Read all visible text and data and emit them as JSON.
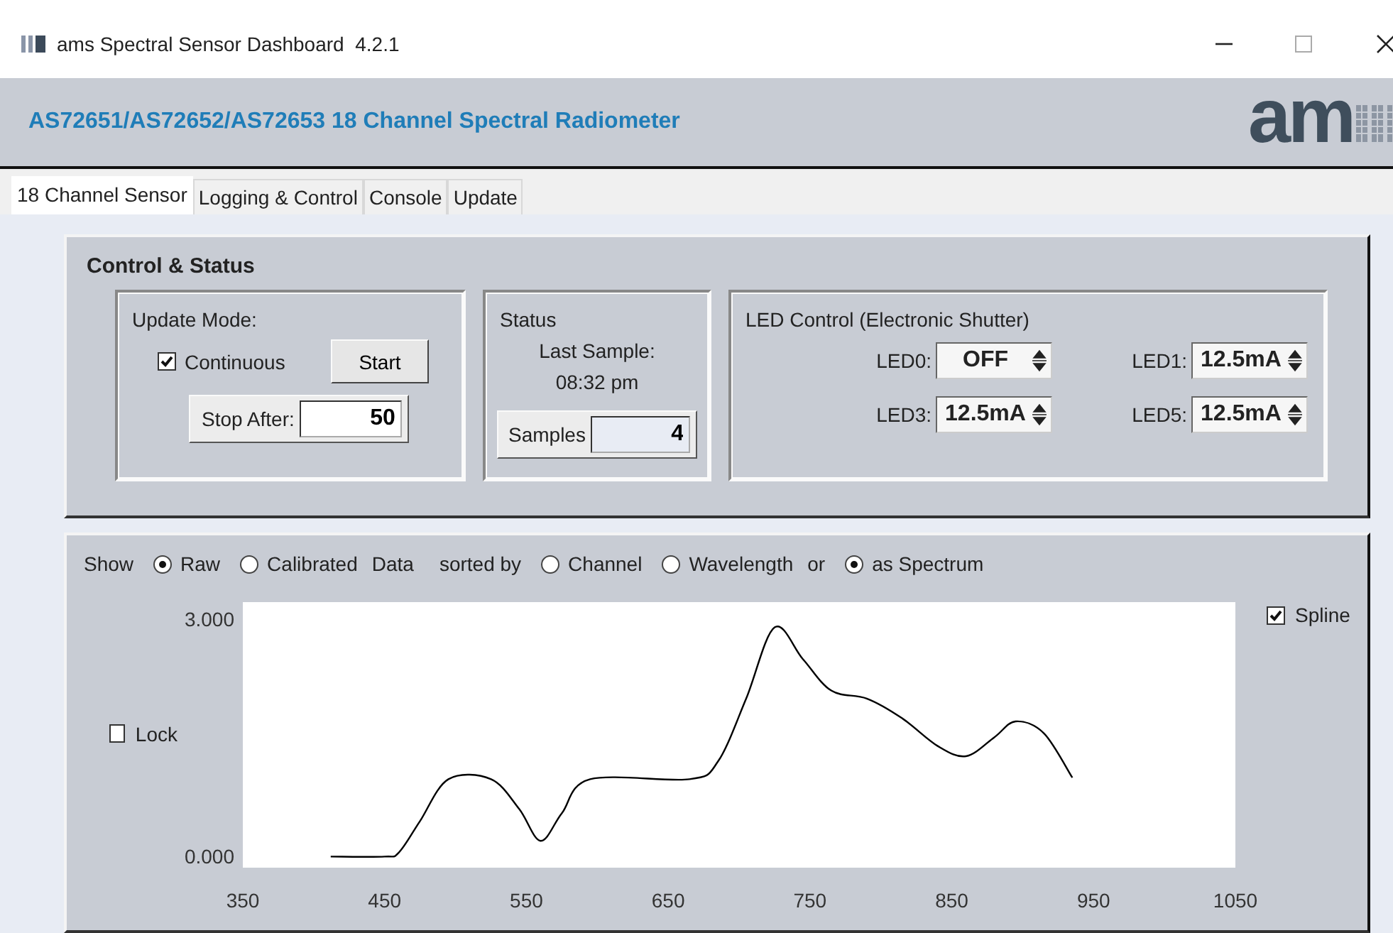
{
  "window": {
    "title": "ams Spectral Sensor Dashboard  4.2.1"
  },
  "header": {
    "title": "AS72651/AS72652/AS72653 18 Channel Spectral Radiometer",
    "logo": "am"
  },
  "tabs": [
    {
      "label": "18 Channel Sensor",
      "selected": true
    },
    {
      "label": "Logging & Control",
      "selected": false
    },
    {
      "label": "Console",
      "selected": false
    },
    {
      "label": "Update",
      "selected": false
    }
  ],
  "control_status": {
    "title": "Control & Status",
    "update_mode": {
      "title": "Update Mode:",
      "continuous": {
        "label": "Continuous",
        "checked": true
      },
      "start_button": "Start",
      "stop_after": {
        "label": "Stop After:",
        "value": "50"
      }
    },
    "status": {
      "title": "Status",
      "last_sample_label": "Last Sample:",
      "last_sample_time": "08:32 pm",
      "samples": {
        "label": "Samples",
        "value": "4"
      }
    },
    "led_control": {
      "title": "LED Control (Electronic Shutter)",
      "leds": [
        {
          "label": "LED0:",
          "value": "OFF"
        },
        {
          "label": "LED1:",
          "value": "12.5mA"
        },
        {
          "label": "LED3:",
          "value": "12.5mA"
        },
        {
          "label": "LED5:",
          "value": "12.5mA"
        }
      ]
    }
  },
  "display": {
    "show_label": "Show",
    "data_options": [
      {
        "label": "Raw",
        "selected": true
      },
      {
        "label": "Calibrated",
        "selected": false
      }
    ],
    "data_label": "Data",
    "sorted_by_label": "sorted by",
    "sort_options": [
      {
        "label": "Channel",
        "selected": false
      },
      {
        "label": "Wavelength",
        "selected": false
      },
      {
        "label": "as Spectrum",
        "selected": true
      }
    ],
    "or_label": "or",
    "lock": {
      "label": "Lock",
      "checked": false
    },
    "spline": {
      "label": "Spline",
      "checked": true
    },
    "chart_data": {
      "type": "line",
      "x": [
        412,
        450,
        460,
        475,
        495,
        525,
        545,
        560,
        575,
        595,
        665,
        685,
        705,
        725,
        745,
        765,
        790,
        815,
        840,
        860,
        880,
        895,
        915,
        935
      ],
      "series": [
        {
          "color": "#000000",
          "values": [
            0,
            0,
            0.05,
            0.45,
            0.98,
            0.98,
            0.6,
            0.2,
            0.55,
            0.98,
            0.98,
            1.2,
            2.0,
            2.9,
            2.5,
            2.1,
            2.0,
            1.75,
            1.4,
            1.27,
            1.51,
            1.71,
            1.56,
            1.0
          ]
        }
      ],
      "xlim": [
        350,
        1050
      ],
      "ylim": [
        -0.14,
        3.22
      ],
      "xticks": [
        350,
        450,
        550,
        650,
        750,
        850,
        950,
        1050
      ],
      "yticks": [
        {
          "value": 0,
          "label": "0.000"
        },
        {
          "value": 3,
          "label": "3.000"
        }
      ]
    }
  }
}
